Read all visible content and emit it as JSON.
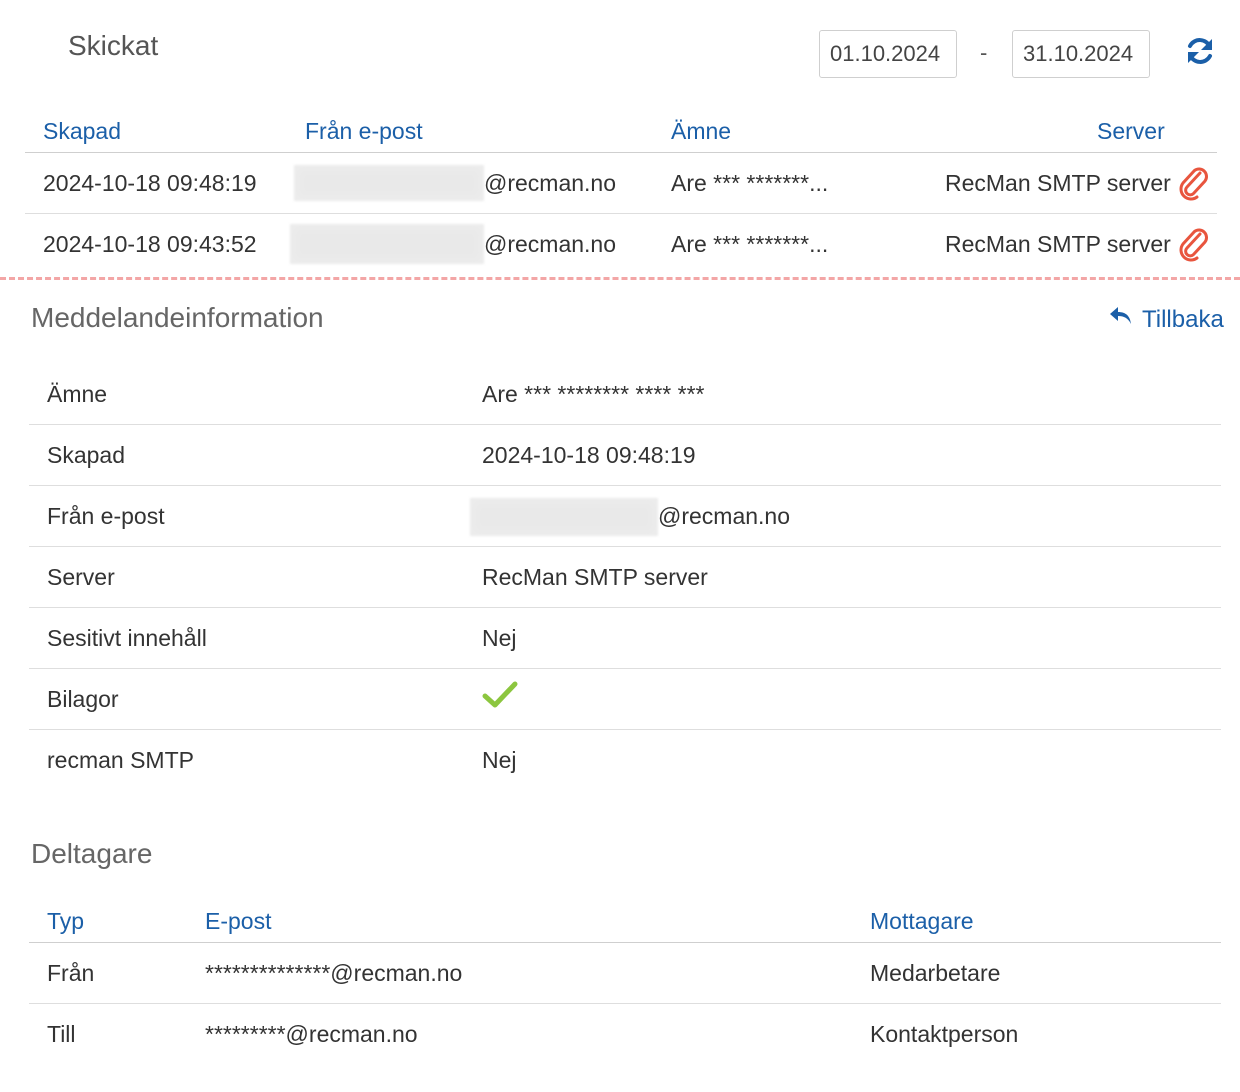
{
  "header": {
    "title": "Skickat",
    "date_from": "01.10.2024",
    "date_separator": "-",
    "date_to": "31.10.2024"
  },
  "sent_table": {
    "columns": {
      "created": "Skapad",
      "from": "Från e-post",
      "subject": "Ämne",
      "server": "Server"
    },
    "rows": [
      {
        "created": "2024-10-18 09:48:19",
        "from_domain": "@recman.no",
        "subject": "Are *** *******...",
        "server": "RecMan SMTP server"
      },
      {
        "created": "2024-10-18 09:43:52",
        "from_domain": "@recman.no",
        "subject": "Are *** *******...",
        "server": "RecMan SMTP server"
      }
    ]
  },
  "message_info": {
    "title": "Meddelandeinformation",
    "back_label": "Tillbaka",
    "rows": [
      {
        "label": "Ämne",
        "value": "Are *** ******** **** ***"
      },
      {
        "label": "Skapad",
        "value": "2024-10-18 09:48:19"
      },
      {
        "label": "Från e-post",
        "value": "@recman.no"
      },
      {
        "label": "Server",
        "value": "RecMan SMTP server"
      },
      {
        "label": "Sesitivt innehåll",
        "value": "Nej"
      },
      {
        "label": "Bilagor",
        "value_icon": "check-icon"
      },
      {
        "label": "recman SMTP",
        "value": "Nej"
      }
    ]
  },
  "participants": {
    "title": "Deltagare",
    "columns": {
      "type": "Typ",
      "email": "E-post",
      "recipient": "Mottagare"
    },
    "rows": [
      {
        "type": "Från",
        "email": "**************@recman.no",
        "recipient": "Medarbetare"
      },
      {
        "type": "Till",
        "email": "*********@recman.no",
        "recipient": "Kontaktperson"
      }
    ]
  },
  "colors": {
    "link": "#1b5fa8",
    "attachment_icon": "#e8553e",
    "check_icon": "#8cc63f",
    "dashed_divider": "#f3a6a6"
  }
}
